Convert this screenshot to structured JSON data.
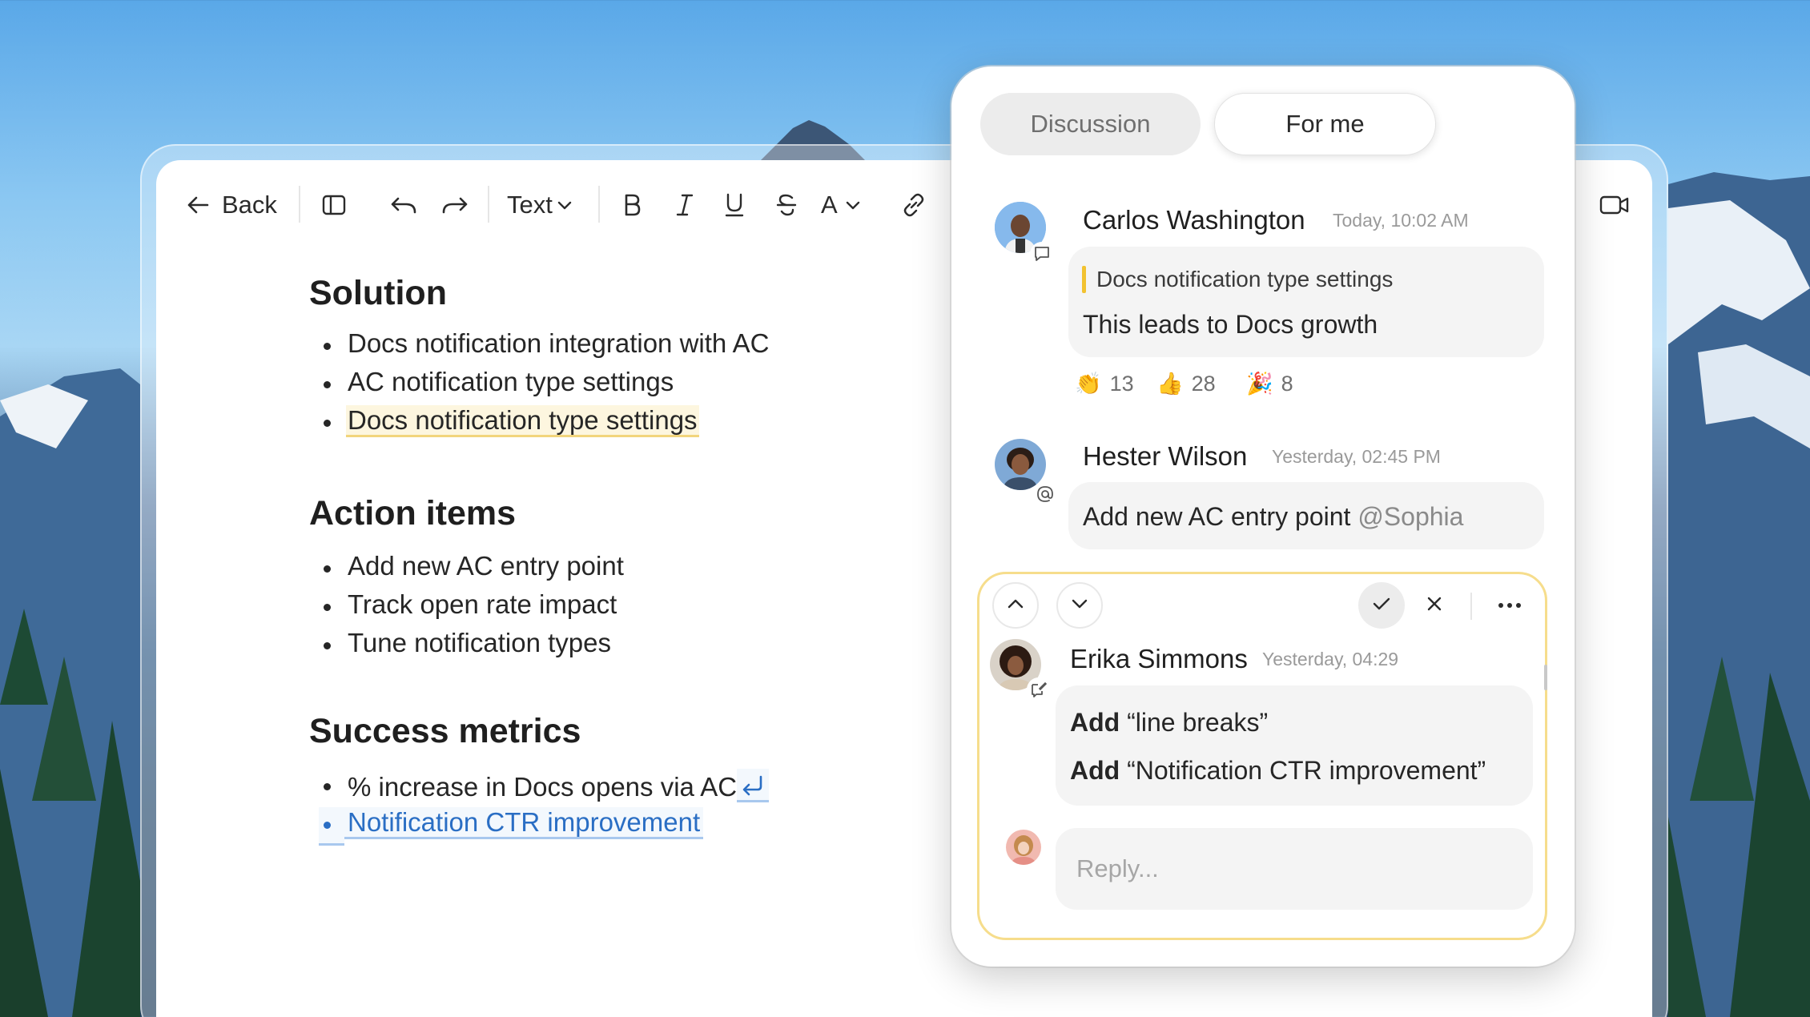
{
  "toolbar": {
    "back_label": "Back",
    "text_style_label": "Text",
    "font_color_label": "A",
    "icons": [
      "back-arrow-icon",
      "sidebar-icon",
      "undo-icon",
      "redo-icon",
      "chevron-down-icon",
      "bold-icon",
      "italic-icon",
      "underline-icon",
      "strikethrough-icon",
      "font-color-icon",
      "link-icon",
      "video-icon"
    ]
  },
  "document": {
    "sections": [
      {
        "heading": "Solution",
        "items": [
          "Docs notification integration with AC",
          "AC notification type settings",
          "Docs notification type settings"
        ]
      },
      {
        "heading": "Action items",
        "items": [
          "Add new AC entry point",
          "Track open rate impact",
          "Tune notification types"
        ]
      },
      {
        "heading": "Success metrics",
        "items": [
          "% increase in Docs opens via AC",
          "Notification CTR improvement"
        ]
      }
    ]
  },
  "comments_panel": {
    "tabs": [
      {
        "label": "Discussion",
        "selected": false
      },
      {
        "label": "For me",
        "selected": true
      }
    ],
    "threads": [
      {
        "author": "Carlos Washington",
        "time": "Today, 10:02 AM",
        "quote": "Docs notification type settings",
        "message": "This leads to Docs growth",
        "badge_icon": "comment-icon",
        "reactions": [
          {
            "emoji": "👏",
            "count": "13"
          },
          {
            "emoji": "👍",
            "count": "28"
          },
          {
            "emoji": "🎉",
            "count": "8"
          }
        ]
      },
      {
        "author": "Hester Wilson",
        "time": "Yesterday, 02:45 PM",
        "message": "Add new AC entry point",
        "mention": "@Sophia",
        "badge_icon": "at-icon"
      }
    ],
    "active_suggestion": {
      "author": "Erika Simmons",
      "time": "Yesterday, 04:29",
      "badge_icon": "edit-suggestion-icon",
      "changes": [
        {
          "action": "Add",
          "text": "“line breaks”"
        },
        {
          "action": "Add",
          "text": "“Notification CTR improvement”"
        }
      ],
      "reply_placeholder": "Reply..."
    }
  },
  "colors": {
    "highlight_yellow": "#f2d57c",
    "link_blue": "#2a6ec4",
    "active_card_border": "#f6dd8c",
    "quote_bar": "#f2c230"
  }
}
